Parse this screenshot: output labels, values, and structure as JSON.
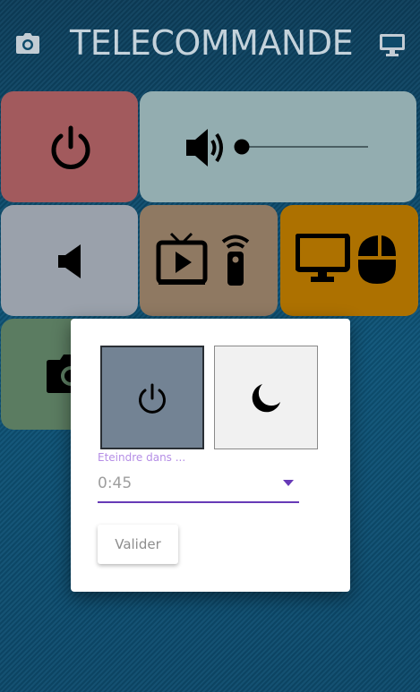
{
  "header": {
    "title": "TELECOMMANDE",
    "left_icon": "camera-icon",
    "right_icon": "desktop-monitor-icon"
  },
  "tiles": [
    {
      "name": "power",
      "icon": "power-icon",
      "color": "#a25a5d"
    },
    {
      "name": "volume",
      "icon": "volume-icon",
      "color": "#93adb0",
      "slider_level": 0.0
    },
    {
      "name": "mute",
      "icon": "speaker-icon",
      "color": "#9aa1ab"
    },
    {
      "name": "tv-remote",
      "icon": "tv-remote-icon",
      "color": "#8f7962"
    },
    {
      "name": "pc",
      "icon": "pc-mouse-icon",
      "color": "#ad7100"
    },
    {
      "name": "camera",
      "icon": "camera-icon",
      "color": "#5b7c61"
    }
  ],
  "dialog": {
    "option_off_icon": "power-icon",
    "option_sleep_icon": "moon-icon",
    "field_label": "Eteindre dans ...",
    "field_value": "0:45",
    "submit_label": "Valider",
    "accent": "#673ab7"
  }
}
